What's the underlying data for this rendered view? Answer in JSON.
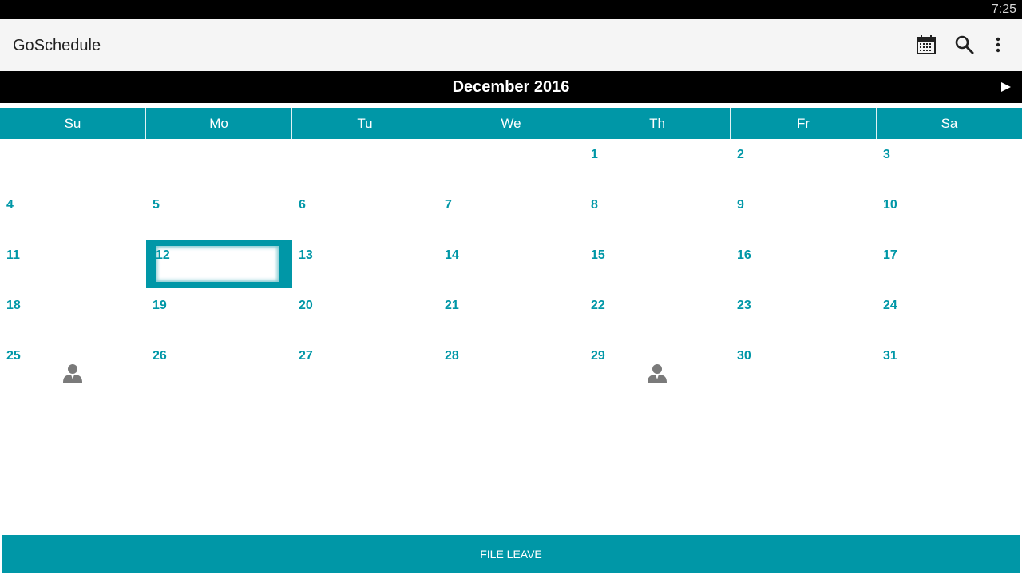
{
  "status_bar": {
    "time": "7:25"
  },
  "app_bar": {
    "title": "GoSchedule",
    "actions": [
      {
        "name": "calendar-icon"
      },
      {
        "name": "search-icon"
      },
      {
        "name": "more-vert-icon"
      }
    ]
  },
  "calendar": {
    "month_label": "December 2016",
    "weekdays": [
      "Su",
      "Mo",
      "Tu",
      "We",
      "Th",
      "Fr",
      "Sa"
    ],
    "weeks": [
      [
        "",
        "",
        "",
        "",
        "1",
        "2",
        "3"
      ],
      [
        "4",
        "5",
        "6",
        "7",
        "8",
        "9",
        "10"
      ],
      [
        "11",
        "12",
        "13",
        "14",
        "15",
        "16",
        "17"
      ],
      [
        "18",
        "19",
        "20",
        "21",
        "22",
        "23",
        "24"
      ],
      [
        "25",
        "26",
        "27",
        "28",
        "29",
        "30",
        "31"
      ]
    ],
    "selected_day": "12",
    "days_with_person": [
      "25",
      "29"
    ],
    "colors": {
      "accent": "#0097a7",
      "month_bar": "#000000"
    }
  },
  "footer": {
    "file_leave_label": "FILE LEAVE"
  }
}
